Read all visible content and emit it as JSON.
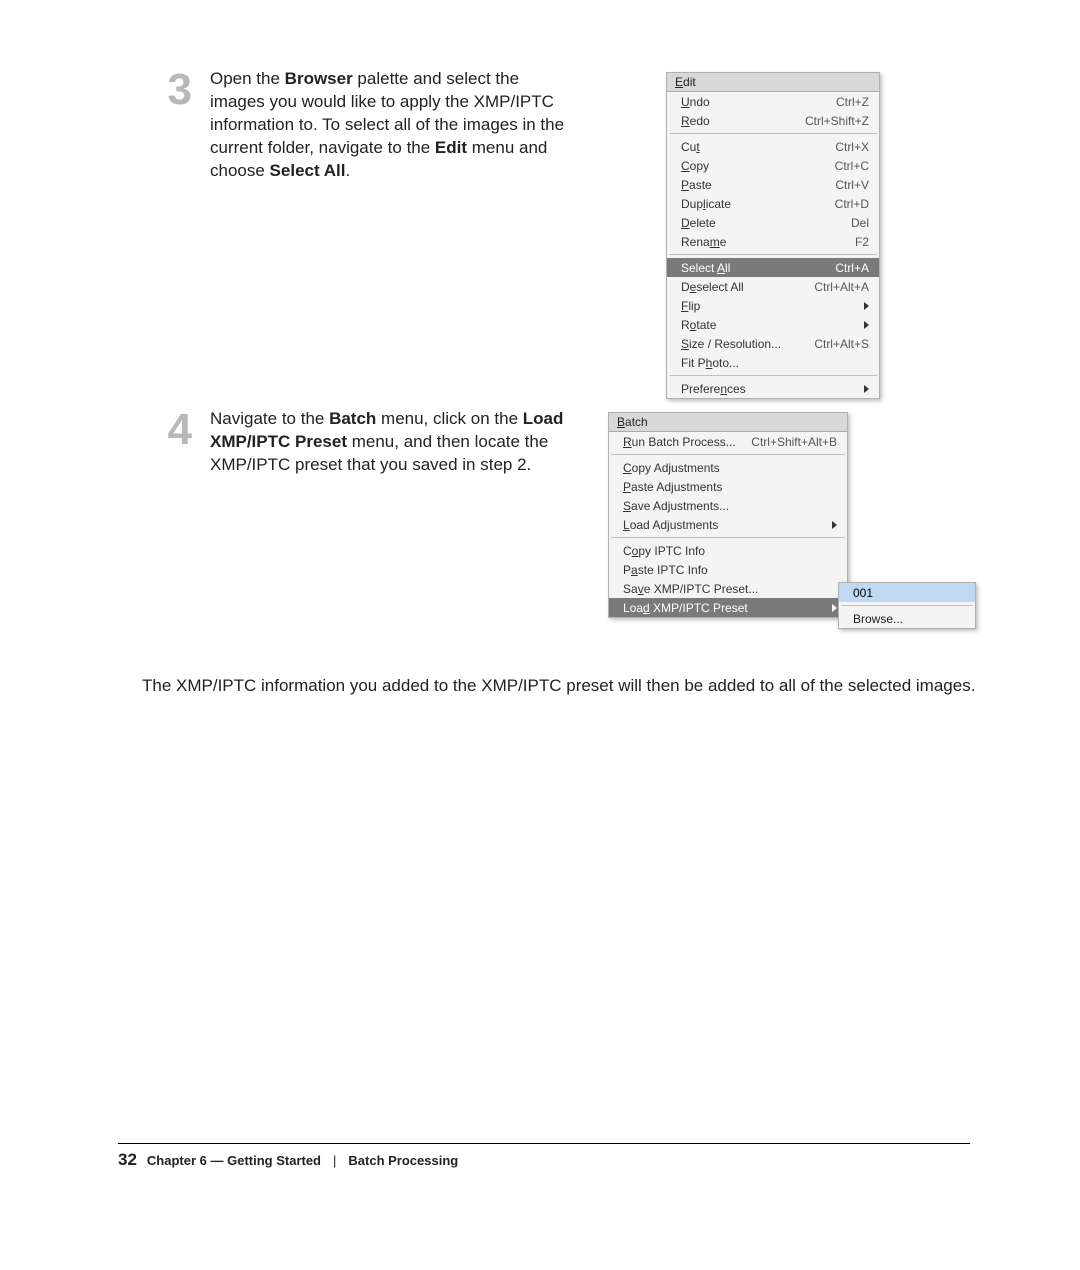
{
  "step3": {
    "number": "3",
    "text_html": "Open the <b>Browser</b> palette and select the images you would like to apply the XMP/IPTC information to. To select all of the images in the current folder, navigate to the <b>Edit</b> menu and choose <b>Select All</b>."
  },
  "step4": {
    "number": "4",
    "text_html": "Navigate to the <b>Batch</b> menu, click on the <b>Load XMP/IPTC Preset</b> menu, and then locate the XMP/IPTC preset that you saved in step 2."
  },
  "result_text": "The XMP/IPTC information you added to the XMP/IPTC preset will then be added to all of the selected images.",
  "edit_menu": {
    "title_html": "<u>E</u>dit",
    "groups": [
      [
        {
          "label_html": "<u>U</u>ndo",
          "shortcut": "Ctrl+Z"
        },
        {
          "label_html": "<u>R</u>edo",
          "shortcut": "Ctrl+Shift+Z"
        }
      ],
      [
        {
          "label_html": "Cu<u>t</u>",
          "shortcut": "Ctrl+X"
        },
        {
          "label_html": "<u>C</u>opy",
          "shortcut": "Ctrl+C"
        },
        {
          "label_html": "<u>P</u>aste",
          "shortcut": "Ctrl+V"
        },
        {
          "label_html": "Dup<u>l</u>icate",
          "shortcut": "Ctrl+D"
        },
        {
          "label_html": "<u>D</u>elete",
          "shortcut": "Del"
        },
        {
          "label_html": "Rena<u>m</u>e",
          "shortcut": "F2"
        }
      ],
      [
        {
          "label_html": "Select <u>A</u>ll",
          "shortcut": "Ctrl+A",
          "highlight": true
        },
        {
          "label_html": "D<u>e</u>select All",
          "shortcut": "Ctrl+Alt+A"
        },
        {
          "label_html": "<u>F</u>lip",
          "submenu": true
        },
        {
          "label_html": "R<u>o</u>tate",
          "submenu": true
        },
        {
          "label_html": "<u>S</u>ize / Resolution...",
          "shortcut": "Ctrl+Alt+S"
        },
        {
          "label_html": "Fit P<u>h</u>oto..."
        }
      ],
      [
        {
          "label_html": "Prefere<u>n</u>ces",
          "submenu": true
        }
      ]
    ]
  },
  "batch_menu": {
    "title_html": "<u>B</u>atch",
    "groups": [
      [
        {
          "label_html": "<u>R</u>un Batch Process...",
          "shortcut": "Ctrl+Shift+Alt+B"
        }
      ],
      [
        {
          "label_html": "<u>C</u>opy Adjustments"
        },
        {
          "label_html": "<u>P</u>aste Adjustments"
        },
        {
          "label_html": "<u>S</u>ave Adjustments..."
        },
        {
          "label_html": "<u>L</u>oad Adjustments",
          "submenu": true
        }
      ],
      [
        {
          "label_html": "C<u>o</u>py IPTC Info"
        },
        {
          "label_html": "P<u>a</u>ste IPTC Info"
        },
        {
          "label_html": "Sa<u>v</u>e XMP/IPTC Preset..."
        },
        {
          "label_html": "Loa<u>d</u> XMP/IPTC Preset",
          "submenu": true,
          "highlight": true
        }
      ]
    ]
  },
  "batch_submenu": {
    "items": [
      {
        "label": "001",
        "highlight": true
      },
      {
        "divider": true
      },
      {
        "label": "Browse..."
      }
    ]
  },
  "footer": {
    "page_number": "32",
    "chapter": "Chapter 6 — Getting Started",
    "section": "Batch Processing"
  }
}
